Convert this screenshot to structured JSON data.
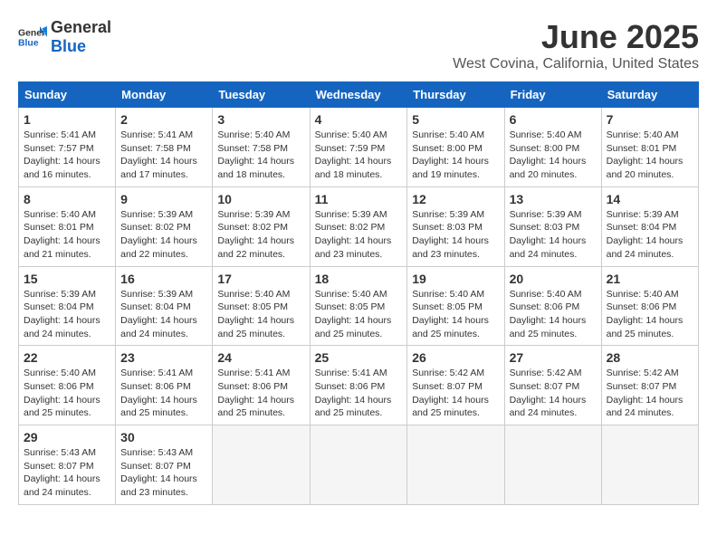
{
  "header": {
    "logo_general": "General",
    "logo_blue": "Blue",
    "month_title": "June 2025",
    "location": "West Covina, California, United States"
  },
  "weekdays": [
    "Sunday",
    "Monday",
    "Tuesday",
    "Wednesday",
    "Thursday",
    "Friday",
    "Saturday"
  ],
  "weeks": [
    [
      {
        "day": "1",
        "sunrise": "5:41 AM",
        "sunset": "7:57 PM",
        "daylight": "14 hours and 16 minutes."
      },
      {
        "day": "2",
        "sunrise": "5:41 AM",
        "sunset": "7:58 PM",
        "daylight": "14 hours and 17 minutes."
      },
      {
        "day": "3",
        "sunrise": "5:40 AM",
        "sunset": "7:58 PM",
        "daylight": "14 hours and 18 minutes."
      },
      {
        "day": "4",
        "sunrise": "5:40 AM",
        "sunset": "7:59 PM",
        "daylight": "14 hours and 18 minutes."
      },
      {
        "day": "5",
        "sunrise": "5:40 AM",
        "sunset": "8:00 PM",
        "daylight": "14 hours and 19 minutes."
      },
      {
        "day": "6",
        "sunrise": "5:40 AM",
        "sunset": "8:00 PM",
        "daylight": "14 hours and 20 minutes."
      },
      {
        "day": "7",
        "sunrise": "5:40 AM",
        "sunset": "8:01 PM",
        "daylight": "14 hours and 20 minutes."
      }
    ],
    [
      {
        "day": "8",
        "sunrise": "5:40 AM",
        "sunset": "8:01 PM",
        "daylight": "14 hours and 21 minutes."
      },
      {
        "day": "9",
        "sunrise": "5:39 AM",
        "sunset": "8:02 PM",
        "daylight": "14 hours and 22 minutes."
      },
      {
        "day": "10",
        "sunrise": "5:39 AM",
        "sunset": "8:02 PM",
        "daylight": "14 hours and 22 minutes."
      },
      {
        "day": "11",
        "sunrise": "5:39 AM",
        "sunset": "8:02 PM",
        "daylight": "14 hours and 23 minutes."
      },
      {
        "day": "12",
        "sunrise": "5:39 AM",
        "sunset": "8:03 PM",
        "daylight": "14 hours and 23 minutes."
      },
      {
        "day": "13",
        "sunrise": "5:39 AM",
        "sunset": "8:03 PM",
        "daylight": "14 hours and 24 minutes."
      },
      {
        "day": "14",
        "sunrise": "5:39 AM",
        "sunset": "8:04 PM",
        "daylight": "14 hours and 24 minutes."
      }
    ],
    [
      {
        "day": "15",
        "sunrise": "5:39 AM",
        "sunset": "8:04 PM",
        "daylight": "14 hours and 24 minutes."
      },
      {
        "day": "16",
        "sunrise": "5:39 AM",
        "sunset": "8:04 PM",
        "daylight": "14 hours and 24 minutes."
      },
      {
        "day": "17",
        "sunrise": "5:40 AM",
        "sunset": "8:05 PM",
        "daylight": "14 hours and 25 minutes."
      },
      {
        "day": "18",
        "sunrise": "5:40 AM",
        "sunset": "8:05 PM",
        "daylight": "14 hours and 25 minutes."
      },
      {
        "day": "19",
        "sunrise": "5:40 AM",
        "sunset": "8:05 PM",
        "daylight": "14 hours and 25 minutes."
      },
      {
        "day": "20",
        "sunrise": "5:40 AM",
        "sunset": "8:06 PM",
        "daylight": "14 hours and 25 minutes."
      },
      {
        "day": "21",
        "sunrise": "5:40 AM",
        "sunset": "8:06 PM",
        "daylight": "14 hours and 25 minutes."
      }
    ],
    [
      {
        "day": "22",
        "sunrise": "5:40 AM",
        "sunset": "8:06 PM",
        "daylight": "14 hours and 25 minutes."
      },
      {
        "day": "23",
        "sunrise": "5:41 AM",
        "sunset": "8:06 PM",
        "daylight": "14 hours and 25 minutes."
      },
      {
        "day": "24",
        "sunrise": "5:41 AM",
        "sunset": "8:06 PM",
        "daylight": "14 hours and 25 minutes."
      },
      {
        "day": "25",
        "sunrise": "5:41 AM",
        "sunset": "8:06 PM",
        "daylight": "14 hours and 25 minutes."
      },
      {
        "day": "26",
        "sunrise": "5:42 AM",
        "sunset": "8:07 PM",
        "daylight": "14 hours and 25 minutes."
      },
      {
        "day": "27",
        "sunrise": "5:42 AM",
        "sunset": "8:07 PM",
        "daylight": "14 hours and 24 minutes."
      },
      {
        "day": "28",
        "sunrise": "5:42 AM",
        "sunset": "8:07 PM",
        "daylight": "14 hours and 24 minutes."
      }
    ],
    [
      {
        "day": "29",
        "sunrise": "5:43 AM",
        "sunset": "8:07 PM",
        "daylight": "14 hours and 24 minutes."
      },
      {
        "day": "30",
        "sunrise": "5:43 AM",
        "sunset": "8:07 PM",
        "daylight": "14 hours and 23 minutes."
      },
      null,
      null,
      null,
      null,
      null
    ]
  ],
  "labels": {
    "sunrise_prefix": "Sunrise: ",
    "sunset_prefix": "Sunset: ",
    "daylight_prefix": "Daylight: "
  }
}
